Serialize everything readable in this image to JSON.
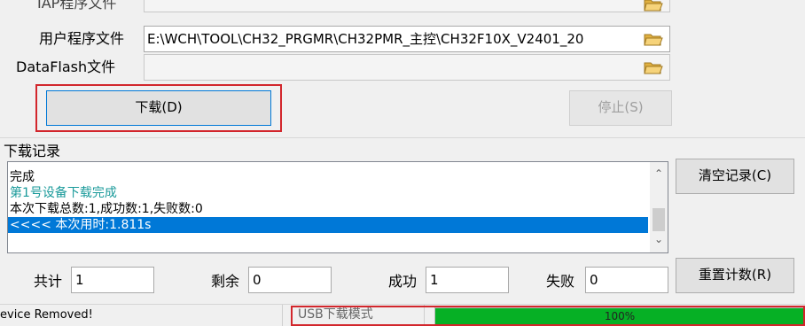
{
  "files": {
    "top_partial_label": "IAP程序文件",
    "user_program_label": "用户程序文件",
    "user_program_path": "E:\\WCH\\TOOL\\CH32_PRGMR\\CH32PMR_主控\\CH32F10X_V2401_20",
    "dataflash_label": "DataFlash文件",
    "dataflash_path": ""
  },
  "buttons": {
    "download": "下载(D)",
    "stop": "停止(S)",
    "clear_log": "清空记录(C)",
    "reset_count": "重置计数(R)"
  },
  "log": {
    "group_label": "下载记录",
    "lines": [
      {
        "text": "完成",
        "color": "#000000"
      },
      {
        "text": "第1号设备下载完成",
        "color": "#1a9a9a"
      },
      {
        "text": "本次下载总数:1,成功数:1,失败数:0",
        "color": "#000000"
      },
      {
        "text": "<<<< 本次用时:1.811s",
        "color": "#ffffff"
      }
    ]
  },
  "counts": {
    "total_label": "共计",
    "total_value": "1",
    "remaining_label": "剩余",
    "remaining_value": "0",
    "success_label": "成功",
    "success_value": "1",
    "fail_label": "失败",
    "fail_value": "0"
  },
  "status": {
    "message": "evice Removed!",
    "mode": "USB下载模式",
    "progress_text": "100%",
    "progress_fraction": 1.0
  },
  "colors": {
    "highlight": "#0078d7",
    "progress": "#06b025",
    "annotation_red": "#d2262c",
    "teal_text": "#1a9a9a"
  }
}
